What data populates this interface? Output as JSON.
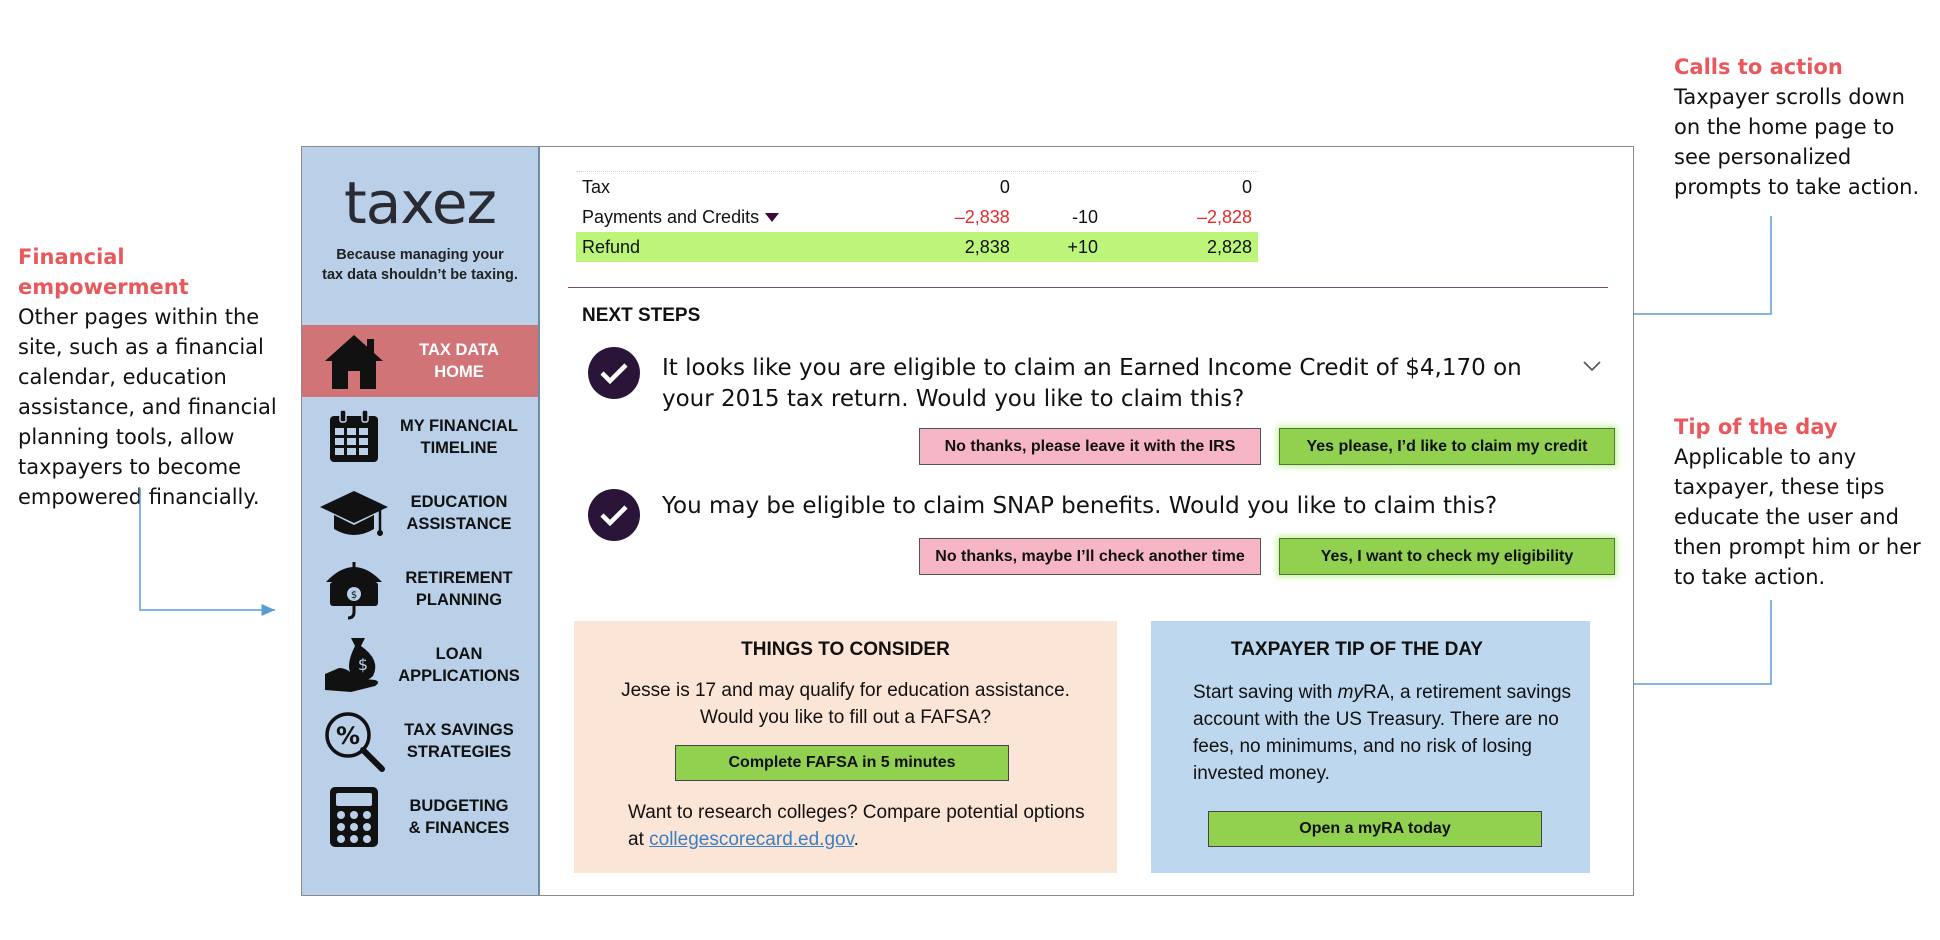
{
  "annotations": {
    "left": {
      "title": "Financial empowerment",
      "body": "Other pages within the site, such as a financial calendar, education assistance, and financial planning tools, allow taxpayers to become empowered financially."
    },
    "right_top": {
      "title": "Calls to action",
      "body": "Taxpayer scrolls down on the home page to see personalized prompts to take action."
    },
    "right_bottom": {
      "title": "Tip of the day",
      "body": "Applicable to any taxpayer, these tips educate the user and then prompt him or her to take action."
    }
  },
  "sidebar": {
    "logo": "taxez",
    "tagline": "Because managing your\ntax data shouldn’t be taxing.",
    "items": [
      {
        "label": "TAX DATA\nHOME",
        "icon": "house-icon",
        "active": true
      },
      {
        "label": "MY FINANCIAL\nTIMELINE",
        "icon": "calendar-icon"
      },
      {
        "label": "EDUCATION\nASSISTANCE",
        "icon": "graduation-cap-icon"
      },
      {
        "label": "RETIREMENT\nPLANNING",
        "icon": "umbrella-money-icon"
      },
      {
        "label": "LOAN\nAPPLICATIONS",
        "icon": "money-bag-hand-icon"
      },
      {
        "label": "TAX SAVINGS\nSTRATEGIES",
        "icon": "percent-magnifier-icon"
      },
      {
        "label": "BUDGETING\n& FINANCES",
        "icon": "calculator-icon"
      }
    ]
  },
  "tax_table": {
    "rows": [
      {
        "label": "Tax",
        "col1": "0",
        "col2": "",
        "col3": "0"
      },
      {
        "label": "Payments and Credits",
        "col1": "–2,838",
        "col2": "-10",
        "col3": "–2,828"
      },
      {
        "label": "Refund",
        "col1": "2,838",
        "col2": "+10",
        "col3": "2,828"
      }
    ]
  },
  "next_steps": {
    "title": "NEXT STEPS",
    "steps": [
      {
        "text": "It looks like you are eligible to claim an Earned Income Credit of $4,170 on your 2015 tax return. Would you like to claim this?",
        "no_label": "No thanks, please leave it with the IRS",
        "yes_label": "Yes please, I’d like to claim my  credit"
      },
      {
        "text": "You may be eligible to claim SNAP benefits. Would you like to claim this?",
        "no_label": "No thanks, maybe I’ll check another time",
        "yes_label": "Yes, I want to check my eligibility"
      }
    ]
  },
  "consider": {
    "title": "THINGS TO CONSIDER",
    "body": "Jesse is 17 and may qualify for education assistance.\nWould you like to  fill out a FAFSA?",
    "button": "Complete FAFSA in 5 minutes",
    "research_text": "Want to research colleges? Compare potential options at ",
    "research_link": "collegescorecard.ed.gov",
    "research_end": "."
  },
  "tip": {
    "title": "TAXPAYER TIP OF THE DAY",
    "body_start": "Start saving with ",
    "body_em": "my",
    "body_rest": "RA, a retirement savings account with the US Treasury. There are no fees, no minimums, and no risk of losing invested money.",
    "button": "Open a myRA today"
  },
  "colors": {
    "accent_red": "#e8585c",
    "sidebar_bg": "#b9d0e8",
    "active_nav": "#d17478",
    "yes_green": "#92d050",
    "no_pink": "#f7b6c6",
    "refund_green": "#bdf57a",
    "arrow_blue": "#5b9bd5"
  }
}
